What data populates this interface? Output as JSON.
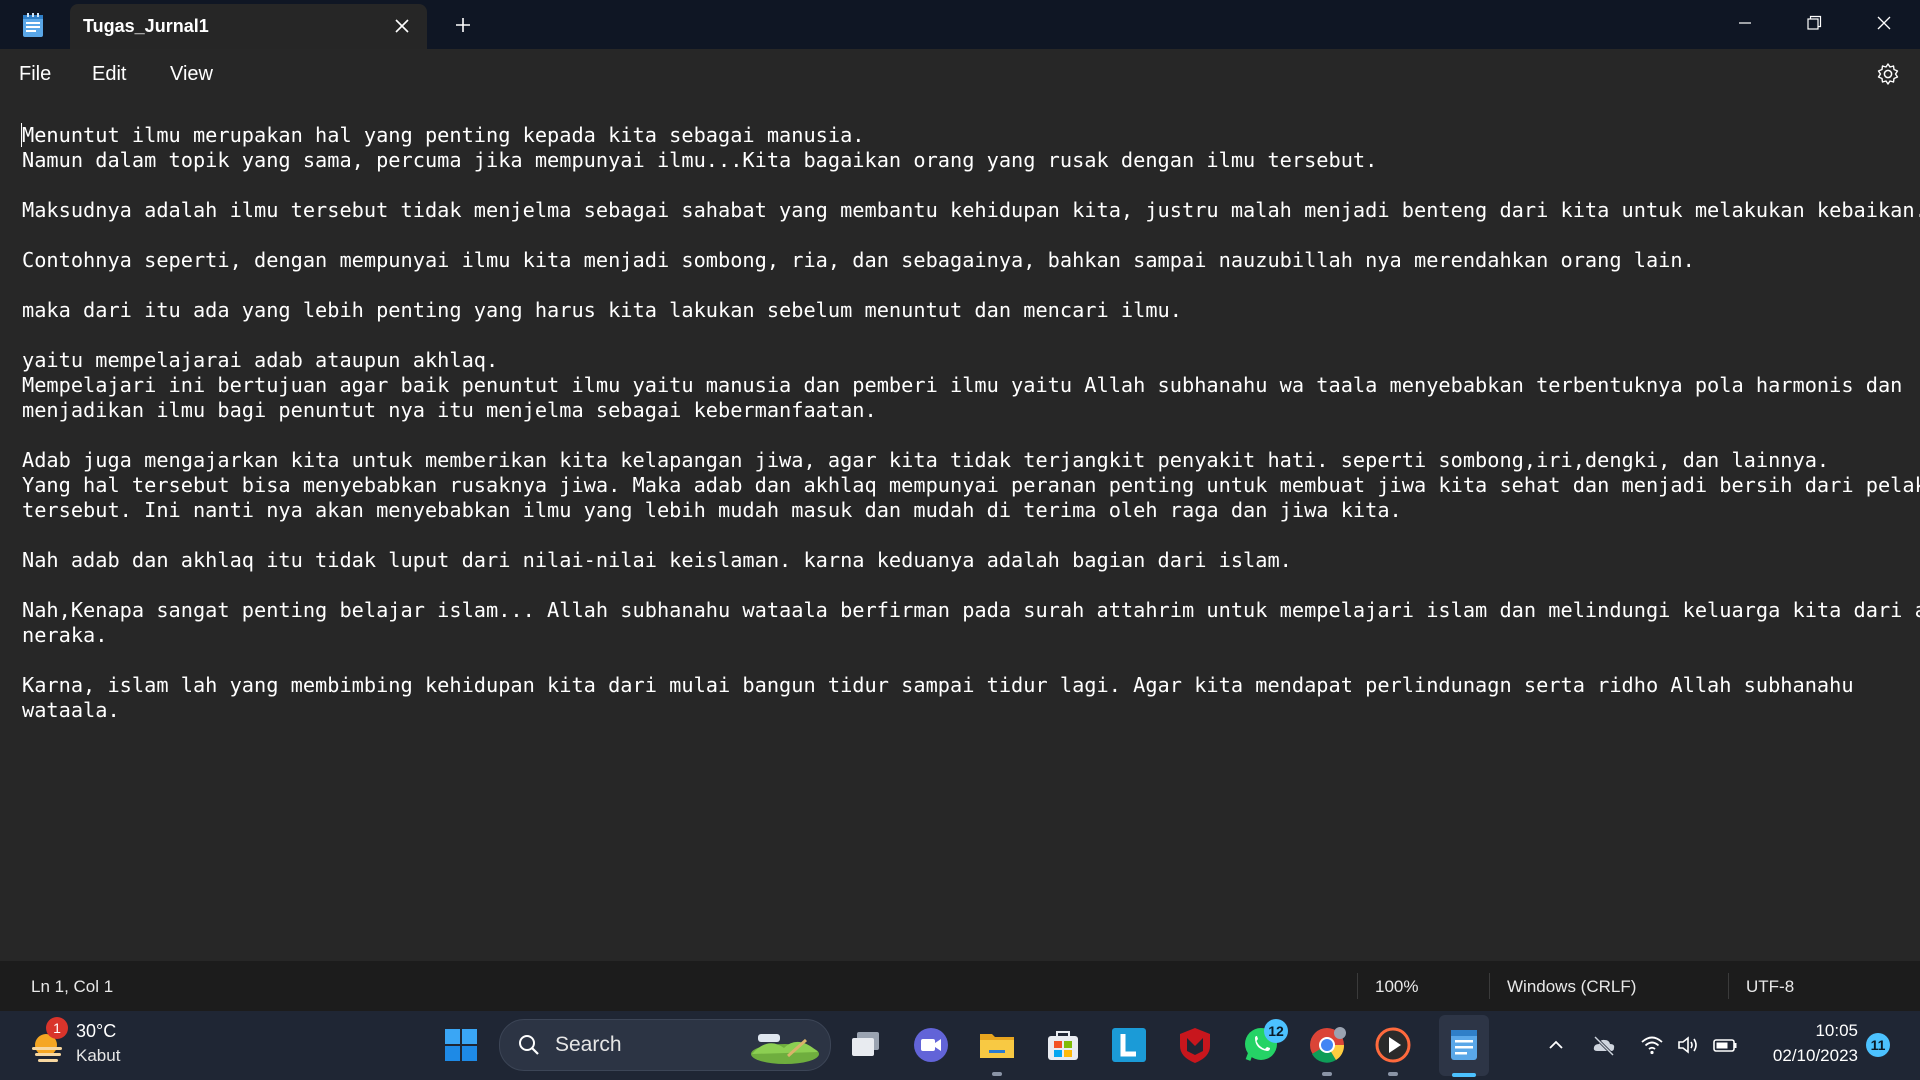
{
  "window": {
    "tab_title": "Tugas_Jurnal1",
    "icons": {
      "app": "notepad-icon",
      "close_tab": "close-icon",
      "new_tab": "plus-icon",
      "minimize": "minimize-icon",
      "maximize": "restore-icon",
      "close": "close-icon"
    }
  },
  "menu": {
    "file": "File",
    "edit": "Edit",
    "view": "View",
    "settings_icon": "gear-icon"
  },
  "editor": {
    "content": "Menuntut ilmu merupakan hal yang penting kepada kita sebagai manusia.\nNamun dalam topik yang sama, percuma jika mempunyai ilmu...Kita bagaikan orang yang rusak dengan ilmu tersebut.\n\nMaksudnya adalah ilmu tersebut tidak menjelma sebagai sahabat yang membantu kehidupan kita, justru malah menjadi benteng dari kita untuk melakukan kebaikan.\n\nContohnya seperti, dengan mempunyai ilmu kita menjadi sombong, ria, dan sebagainya, bahkan sampai nauzubillah nya merendahkan orang lain.\n\nmaka dari itu ada yang lebih penting yang harus kita lakukan sebelum menuntut dan mencari ilmu.\n\nyaitu mempelajarai adab ataupun akhlaq.\nMempelajari ini bertujuan agar baik penuntut ilmu yaitu manusia dan pemberi ilmu yaitu Allah subhanahu wa taala menyebabkan terbentuknya pola harmonis dan\nmenjadikan ilmu bagi penuntut nya itu menjelma sebagai kebermanfaatan.\n\nAdab juga mengajarkan kita untuk memberikan kita kelapangan jiwa, agar kita tidak terjangkit penyakit hati. seperti sombong,iri,dengki, dan lainnya.\nYang hal tersebut bisa menyebabkan rusaknya jiwa. Maka adab dan akhlaq mempunyai peranan penting untuk membuat jiwa kita sehat dan menjadi bersih dari pelaku\ntersebut. Ini nanti nya akan menyebabkan ilmu yang lebih mudah masuk dan mudah di terima oleh raga dan jiwa kita.\n\nNah adab dan akhlaq itu tidak luput dari nilai-nilai keislaman. karna keduanya adalah bagian dari islam.\n\nNah,Kenapa sangat penting belajar islam... Allah subhanahu wataala berfirman pada surah attahrim untuk mempelajari islam dan melindungi keluarga kita dari api\nneraka.\n\nKarna, islam lah yang membimbing kehidupan kita dari mulai bangun tidur sampai tidur lagi. Agar kita mendapat perlindunagn serta ridho Allah subhanahu\nwataala."
  },
  "status": {
    "position": "Ln 1, Col 1",
    "zoom": "100%",
    "line_ending": "Windows (CRLF)",
    "encoding": "UTF-8"
  },
  "taskbar": {
    "weather": {
      "temp": "30°C",
      "desc": "Kabut",
      "badge": "1",
      "icon": "weather-sun-haze-icon"
    },
    "search_label": "Search",
    "apps": [
      {
        "name": "start-button",
        "icon": "windows-start-icon"
      },
      {
        "name": "task-view-button",
        "icon": "task-view-icon"
      },
      {
        "name": "teams-chat-button",
        "icon": "video-chat-icon"
      },
      {
        "name": "file-explorer-button",
        "icon": "folder-icon"
      },
      {
        "name": "microsoft-store-button",
        "icon": "store-icon"
      },
      {
        "name": "l-app-button",
        "icon": "l-app-icon"
      },
      {
        "name": "mcafee-button",
        "icon": "mcafee-shield-icon"
      },
      {
        "name": "whatsapp-button",
        "icon": "whatsapp-icon"
      },
      {
        "name": "chrome-button",
        "icon": "chrome-icon"
      },
      {
        "name": "media-player-button",
        "icon": "play-icon"
      },
      {
        "name": "notepad-button",
        "icon": "notepad-icon"
      }
    ],
    "whatsapp_badge": "12",
    "tray": {
      "icons": [
        "chevron-up-icon",
        "onedrive-offline-icon",
        "wifi-icon",
        "volume-icon",
        "battery-icon"
      ],
      "time": "10:05",
      "date": "02/10/2023",
      "notifications": "11"
    }
  }
}
